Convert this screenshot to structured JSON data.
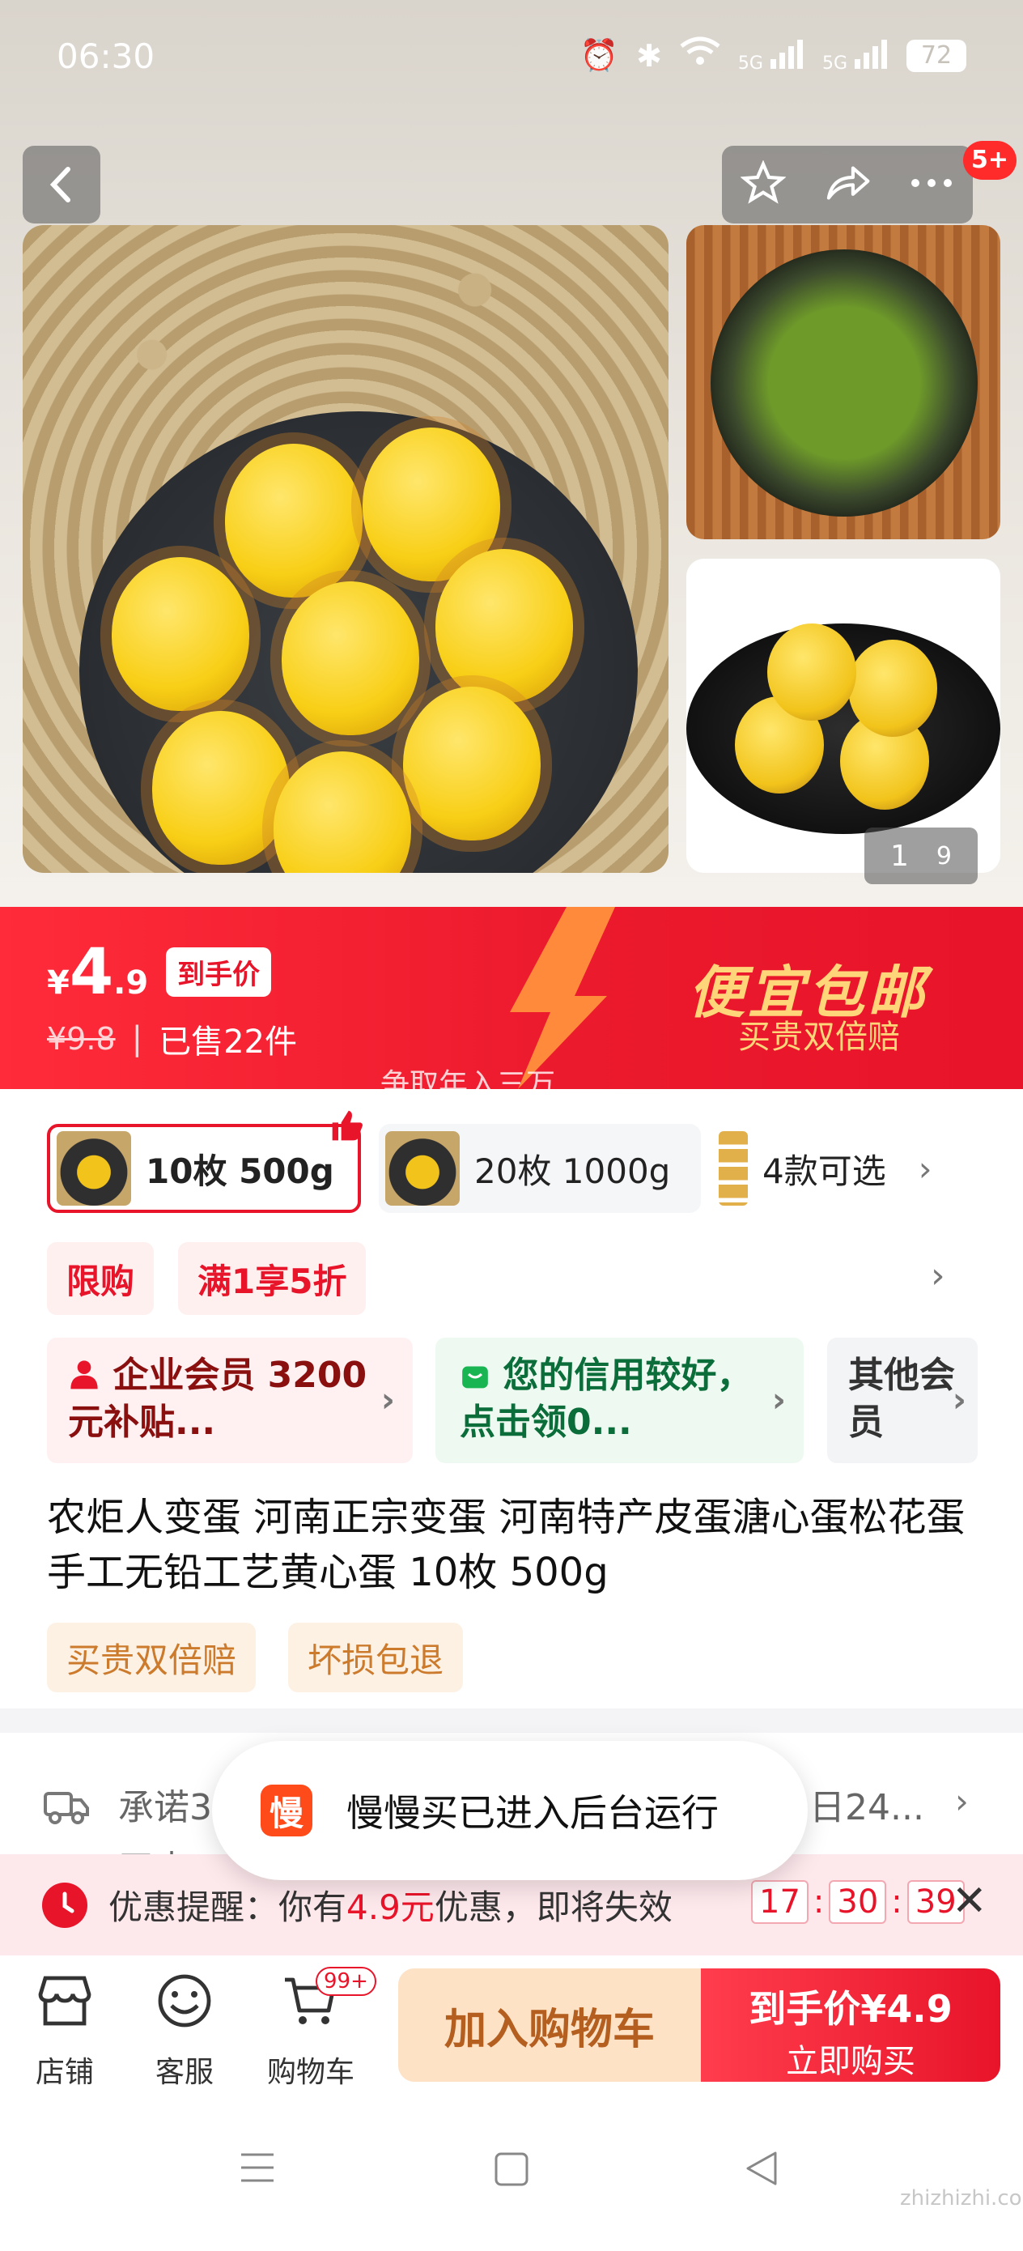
{
  "status_bar": {
    "time": "06:30",
    "network_1": "5G",
    "network_2": "5G",
    "battery": "72"
  },
  "header": {
    "notification_count": "5+"
  },
  "gallery": {
    "current_page": "1",
    "total_pages": "9"
  },
  "price_banner": {
    "currency": "¥",
    "price_int": "4",
    "price_dec": ".9",
    "price_tag": "到手价",
    "original_price": "¥9.8",
    "sold": "已售22件",
    "title": "便宜包邮",
    "subtitle": "买贵双倍赔",
    "marquee": "争取年入三万",
    "colors": {
      "banner": "#e8142a",
      "banner_text": "#ffd57a"
    }
  },
  "sku": {
    "options": [
      {
        "label": "10枚 500g",
        "selected": true
      },
      {
        "label": "20枚 1000g",
        "selected": false
      }
    ],
    "more": "4款可选"
  },
  "tags": [
    "限购",
    "满1享5折"
  ],
  "member_cards": {
    "enterprise": "企业会员 3200元补贴...",
    "credit": "您的信用较好，点击领0...",
    "other": "其他会员"
  },
  "product": {
    "title": "农炬人变蛋 河南正宗变蛋 河南特产皮蛋溏心蛋松花蛋手工无铅工艺黄心蛋 10枚 500g",
    "badges": [
      "买贵双倍赔",
      "坏损包退"
    ]
  },
  "shipping": {
    "text": "承诺3",
    "text_line2": "天内",
    "right": "日24..."
  },
  "toast": {
    "icon_text": "慢",
    "message": "慢慢买已进入后台运行"
  },
  "coupon_reminder": {
    "prefix": "优惠提醒：你有",
    "amount": "4.9元",
    "suffix": "优惠，即将失效",
    "timer": [
      "17",
      "30",
      "39"
    ]
  },
  "bottom_bar": {
    "shop": "店铺",
    "service": "客服",
    "cart": "购物车",
    "cart_badge": "99+",
    "add_to_cart": "加入购物车",
    "buy_price": "到手价¥4.9",
    "buy_now": "立即购买"
  },
  "watermark": "zhizhizhi.com"
}
